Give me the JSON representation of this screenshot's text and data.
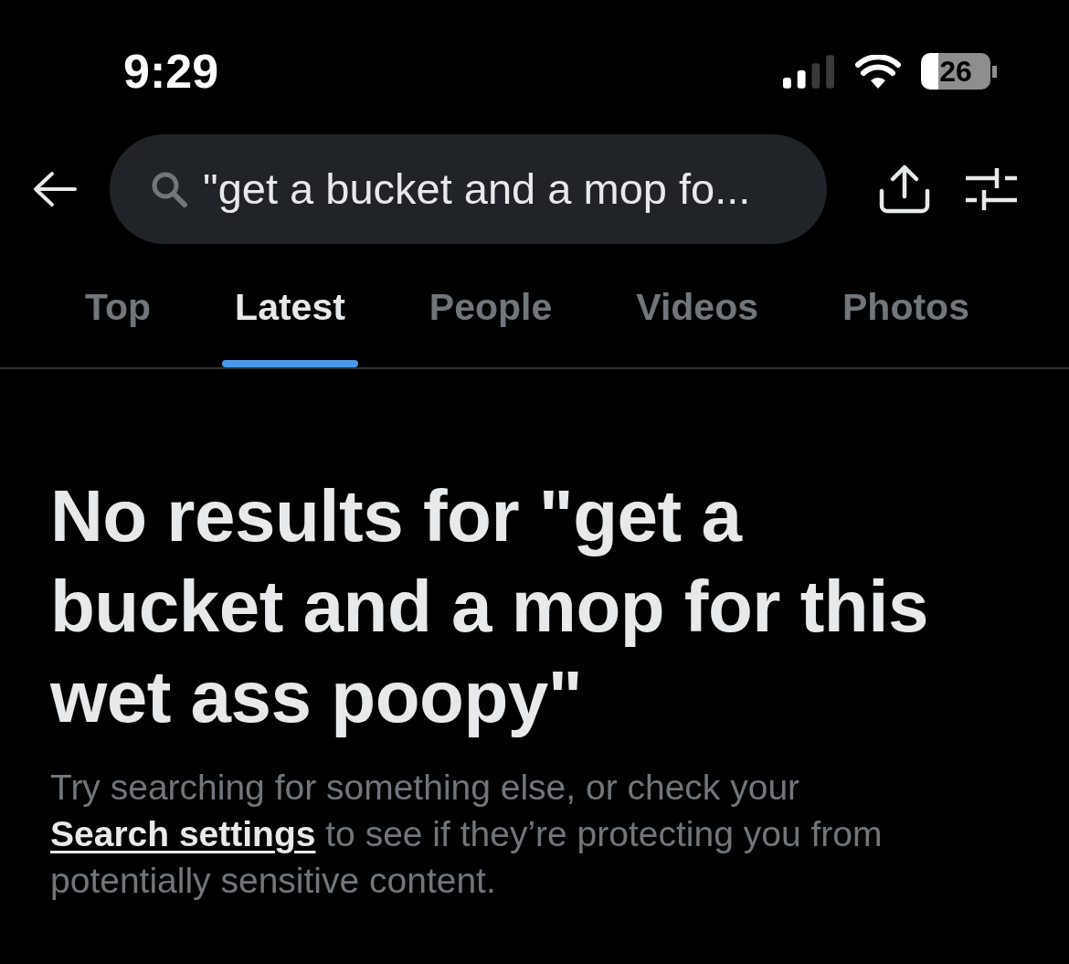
{
  "status_bar": {
    "time": "9:29",
    "battery": "26"
  },
  "search_bar": {
    "value": "\"get a bucket and a mop fo..."
  },
  "tabs": [
    {
      "label": "Top",
      "selected": false
    },
    {
      "label": "Latest",
      "selected": true
    },
    {
      "label": "People",
      "selected": false
    },
    {
      "label": "Videos",
      "selected": false
    },
    {
      "label": "Photos",
      "selected": false
    }
  ],
  "empty_state": {
    "title": "No results for \"get a bucket and a mop for this wet ass poopy\"",
    "message_before": "Try searching for something else, or check your ",
    "link": "Search settings",
    "message_after": " to see if they’re protecting you from potentially sensitive content."
  }
}
